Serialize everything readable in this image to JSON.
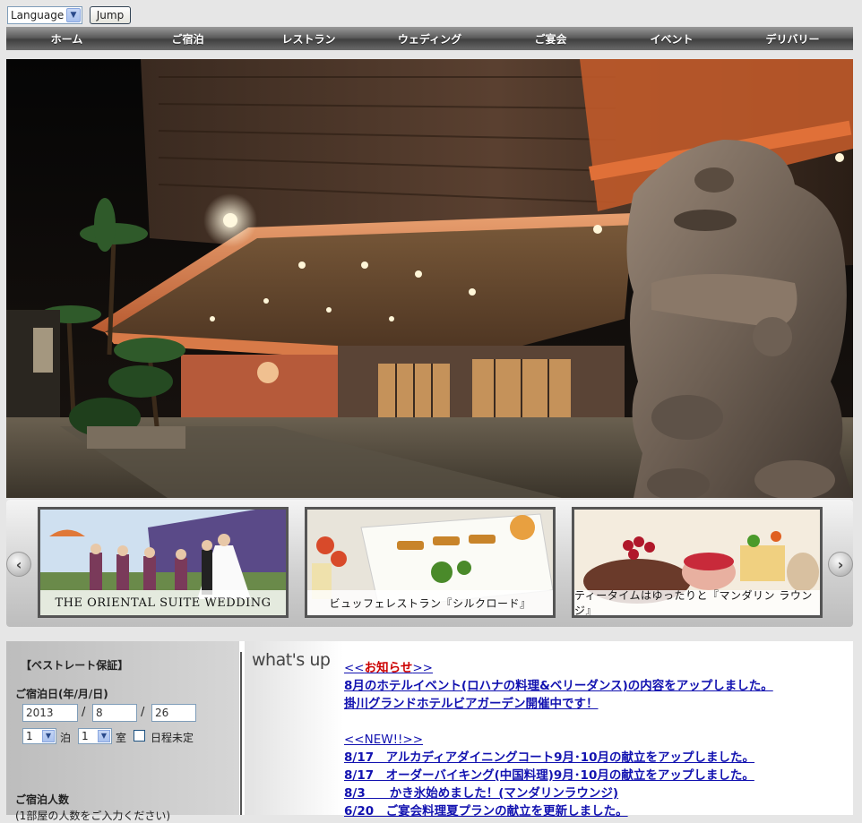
{
  "topbar": {
    "language_select": "Language",
    "jump_button": "Jump"
  },
  "nav": {
    "items": [
      "ホーム",
      "ご宿泊",
      "レストラン",
      "ウェディング",
      "ご宴会",
      "イベント",
      "デリバリー"
    ]
  },
  "slider": {
    "thumbs": [
      {
        "caption": "THE ORIENTAL SUITE WEDDING"
      },
      {
        "caption": "ビュッフェレストラン『シルクロード』"
      },
      {
        "caption": "ティータイムはゆったりと『マンダリン ラウンジ』"
      }
    ],
    "prev_icon": "chevron-left-icon",
    "next_icon": "chevron-right-icon"
  },
  "booking": {
    "title": "【ベストレート保証】",
    "date_label": "ご宿泊日(年/月/日)",
    "year": "2013",
    "month": "8",
    "day": "26",
    "date_sep": "/",
    "nights": "1",
    "nights_unit": "泊",
    "rooms": "1",
    "rooms_unit": "室",
    "undecided_label": "日程未定",
    "guests_label": "ご宿泊人数",
    "guests_note": "(1部屋の人数をご入力ください)"
  },
  "whats_up": {
    "title": "what's up"
  },
  "news": {
    "notice_head_prefix": "<<",
    "notice_head_label": "お知らせ",
    "notice_head_suffix": ">>",
    "notices": [
      "8月のホテルイベント(ロハナの料理&ベリーダンス)の内容をアップしました。",
      "掛川グランドホテルビアガーデン開催中です！"
    ],
    "new_head": "<<NEW!!>>",
    "new_items": [
      "8/17　アルカディアダイニングコート9月･10月の献立をアップしました。",
      "8/17　オーダーバイキング(中国料理)9月･10月の献立をアップしました。",
      "8/3　　かき氷始めました！(マンダリンラウンジ)",
      "6/20　ご宴会料理夏プランの献立を更新しました。"
    ]
  },
  "colors": {
    "nav_bg": "#4a4a4a",
    "link": "#1212b0",
    "notice_red": "#cc0000"
  }
}
